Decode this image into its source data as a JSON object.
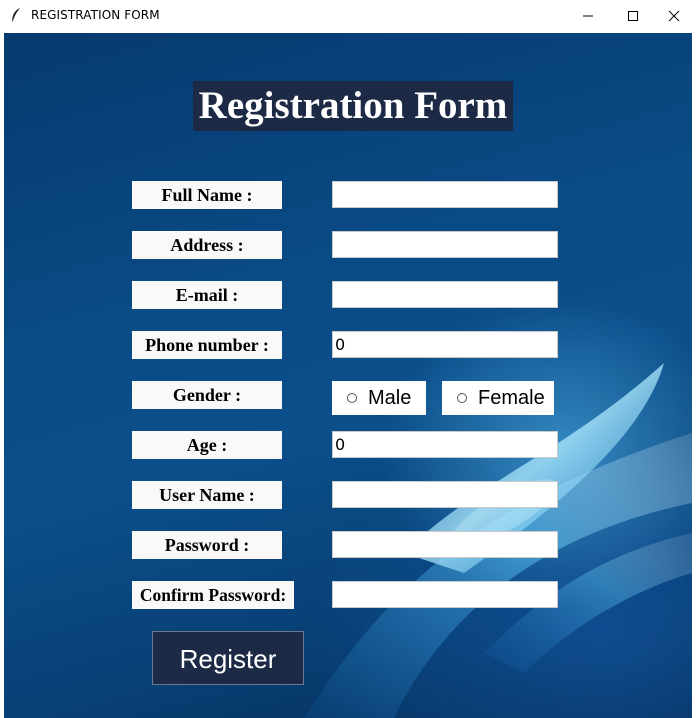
{
  "window": {
    "title": "REGISTRATION FORM"
  },
  "form": {
    "heading": "Registration Form",
    "fields": [
      {
        "label": "Full Name :",
        "value": ""
      },
      {
        "label": "Address :",
        "value": ""
      },
      {
        "label": "E-mail :",
        "value": ""
      },
      {
        "label": "Phone number :",
        "value": "0"
      },
      {
        "label": "Gender :"
      },
      {
        "label": "Age :",
        "value": "0"
      },
      {
        "label": "User Name :",
        "value": ""
      },
      {
        "label": "Password :",
        "value": ""
      },
      {
        "label": "Confirm Password:",
        "value": ""
      }
    ],
    "gender_options": [
      "Male",
      "Female"
    ],
    "register_label": "Register"
  },
  "colors": {
    "panel": "#1c2a45",
    "label_bg": "#fbf8f8",
    "background": "#0b4f8b"
  }
}
